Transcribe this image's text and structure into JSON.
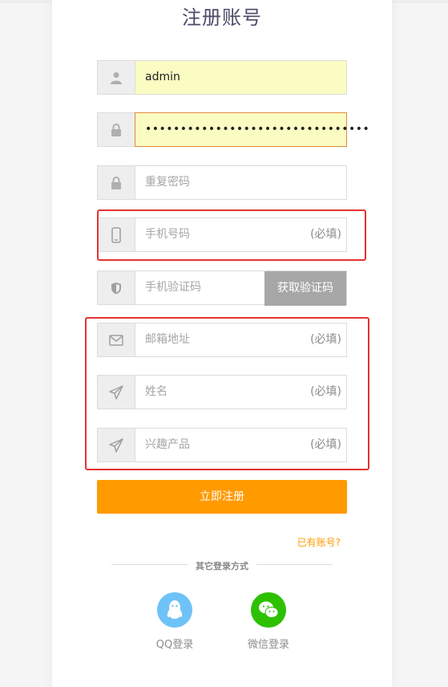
{
  "title": "注册账号",
  "fields": {
    "username": {
      "value": "admin",
      "icon": "user-icon"
    },
    "password": {
      "value": "••••••••••••••••••••••••••••••••",
      "icon": "lock-icon"
    },
    "repeat_password": {
      "placeholder": "重复密码",
      "icon": "lock-icon"
    },
    "phone": {
      "placeholder": "手机号码",
      "required": "(必填)",
      "icon": "phone-icon"
    },
    "sms_code": {
      "placeholder": "手机验证码",
      "button": "获取验证码",
      "icon": "shield-icon"
    },
    "email": {
      "placeholder": "邮箱地址",
      "required": "(必填)",
      "icon": "mail-icon"
    },
    "name": {
      "placeholder": "姓名",
      "required": "(必填)",
      "icon": "paper-plane-icon"
    },
    "interest": {
      "placeholder": "兴趣产品",
      "required": "(必填)",
      "icon": "paper-plane-icon"
    }
  },
  "submit_label": "立即注册",
  "have_account": "已有账号?",
  "other_login": "其它登录方式",
  "social": {
    "qq": {
      "label": "QQ登录",
      "color": "#6ec2f7"
    },
    "wechat": {
      "label": "微信登录",
      "color": "#2dc100"
    }
  },
  "colors": {
    "accent": "#ff9a00",
    "highlight": "#e43232",
    "autofill": "#fafcc2"
  }
}
